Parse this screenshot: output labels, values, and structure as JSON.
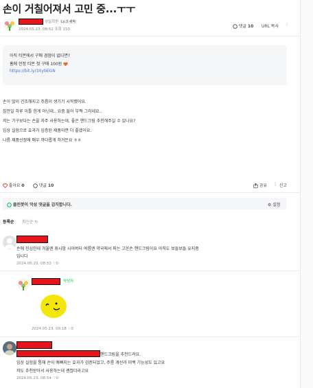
{
  "post": {
    "title": "손이 거칠어져서 고민 중...ㅜㅜ",
    "author_grade": "성실회원",
    "author_level": "Lv.3 새싹",
    "date": "2024.05.23. 08:52",
    "views_label": "조회 150",
    "comments_label": "댓글",
    "comments_count": "10",
    "url_copy": "URL 복사",
    "more": "⋮"
  },
  "ad": {
    "line1": "아직 티몬에서 구매 경험이 없다면?",
    "line2": "홈에 한정 티몬 첫 구매 100원",
    "link": "https://bit.ly/3XybEGN"
  },
  "body_lines": [
    "손이 많이 건조해지고 주름이 생기기 시작했어요.",
    "집안일 하루 이틀 한게 아닌데.. 요즘 들어 부쩍 그러네요..",
    "저는 기구보다는 손을 자주 사용하는데, 좋은 핸드크림 추천해주실 수 있나요?",
    "임상 실험으로 효과가 입증된 제품이면 더 좋겠어요.",
    "나름 제품선정에 매우 까다롭게 하거든요 ㅎㅎ"
  ],
  "actions": {
    "like_label": "좋아요",
    "like_count": "0",
    "comment_label": "댓글",
    "comment_count": "10",
    "share": "공유",
    "report": "신고"
  },
  "notice": {
    "text": "클린봇이 악성 댓글을 감지합니다.",
    "settings": "설정"
  },
  "sort": {
    "registered": "등록순",
    "latest": "최신순"
  },
  "comments": [
    {
      "text_line1": "손에 진심인데 겨울엔 휴시맘 시어버터 여름엔 약국에서 파는 고운손 핸드크림이요 아직도 보들보들 유지중",
      "text_line2": "입니다",
      "date": "2024.05.23. 08:53",
      "reaction": "♡0"
    },
    {
      "author_badge": "작성자",
      "date": "2024.05.23. 09:18",
      "reaction": "♡0"
    },
    {
      "text_line1_suffix": "핸드크림을 추천드려요.",
      "text_line2": "임상 실험을 통해 손이 예뻐지는 효과가 검증되었고, 주름 개선과 미백 기능성도 있고요",
      "text_line3": "저도 추천받아서 사용하는데 괜찮더라고요",
      "date": "2024.05.23. 08:54",
      "reaction": "♡0"
    }
  ],
  "colors": {
    "redaction": "#e6151c",
    "accent_green": "#03c75a",
    "link_blue": "#3b7bd4",
    "heart_red": "#e0332f",
    "emoji_yellow": "#f5e60a"
  }
}
